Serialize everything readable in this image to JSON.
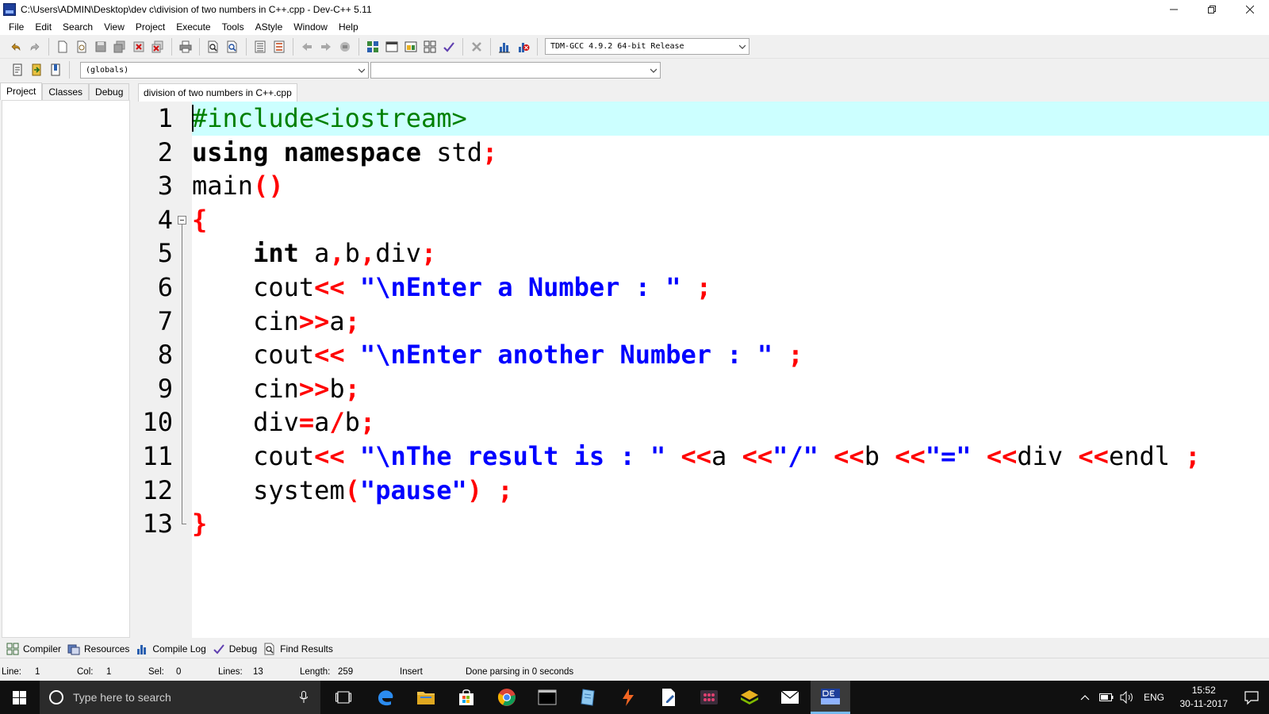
{
  "window": {
    "title": "C:\\Users\\ADMIN\\Desktop\\dev c\\division of two numbers in C++.cpp - Dev-C++ 5.11",
    "minimize": "—",
    "restore": "❐",
    "close": "✕"
  },
  "menu": [
    "File",
    "Edit",
    "Search",
    "View",
    "Project",
    "Execute",
    "Tools",
    "AStyle",
    "Window",
    "Help"
  ],
  "toolbar": {
    "compiler_selected": "TDM-GCC 4.9.2 64-bit Release",
    "scope_selected": "(globals)",
    "member_selected": ""
  },
  "left_panel": {
    "tabs": [
      "Project",
      "Classes",
      "Debug"
    ],
    "active_tab": "Project"
  },
  "editor": {
    "tab_label": "division of two numbers in C++.cpp",
    "current_line": 1,
    "lines": [
      {
        "n": "1",
        "tokens": [
          {
            "t": "#include<iostream>",
            "c": "pre"
          }
        ]
      },
      {
        "n": "2",
        "tokens": [
          {
            "t": "using",
            "c": "kw"
          },
          {
            "t": " ",
            "c": "id"
          },
          {
            "t": "namespace",
            "c": "kw"
          },
          {
            "t": " std",
            "c": "id"
          },
          {
            "t": ";",
            "c": "sym"
          }
        ]
      },
      {
        "n": "3",
        "tokens": [
          {
            "t": "main",
            "c": "id"
          },
          {
            "t": "()",
            "c": "sym"
          }
        ]
      },
      {
        "n": "4",
        "tokens": [
          {
            "t": "{",
            "c": "sym"
          }
        ]
      },
      {
        "n": "5",
        "tokens": [
          {
            "t": "    ",
            "c": "id"
          },
          {
            "t": "int",
            "c": "kw"
          },
          {
            "t": " a",
            "c": "id"
          },
          {
            "t": ",",
            "c": "sym"
          },
          {
            "t": "b",
            "c": "id"
          },
          {
            "t": ",",
            "c": "sym"
          },
          {
            "t": "div",
            "c": "id"
          },
          {
            "t": ";",
            "c": "sym"
          }
        ]
      },
      {
        "n": "6",
        "tokens": [
          {
            "t": "    cout",
            "c": "id"
          },
          {
            "t": "<<",
            "c": "sym"
          },
          {
            "t": " ",
            "c": "id"
          },
          {
            "t": "\"\\nEnter a Number : \"",
            "c": "str"
          },
          {
            "t": " ",
            "c": "id"
          },
          {
            "t": ";",
            "c": "sym"
          }
        ]
      },
      {
        "n": "7",
        "tokens": [
          {
            "t": "    cin",
            "c": "id"
          },
          {
            "t": ">>",
            "c": "sym"
          },
          {
            "t": "a",
            "c": "id"
          },
          {
            "t": ";",
            "c": "sym"
          }
        ]
      },
      {
        "n": "8",
        "tokens": [
          {
            "t": "    cout",
            "c": "id"
          },
          {
            "t": "<<",
            "c": "sym"
          },
          {
            "t": " ",
            "c": "id"
          },
          {
            "t": "\"\\nEnter another Number : \"",
            "c": "str"
          },
          {
            "t": " ",
            "c": "id"
          },
          {
            "t": ";",
            "c": "sym"
          }
        ]
      },
      {
        "n": "9",
        "tokens": [
          {
            "t": "    cin",
            "c": "id"
          },
          {
            "t": ">>",
            "c": "sym"
          },
          {
            "t": "b",
            "c": "id"
          },
          {
            "t": ";",
            "c": "sym"
          }
        ]
      },
      {
        "n": "10",
        "tokens": [
          {
            "t": "    div",
            "c": "id"
          },
          {
            "t": "=",
            "c": "sym"
          },
          {
            "t": "a",
            "c": "id"
          },
          {
            "t": "/",
            "c": "sym"
          },
          {
            "t": "b",
            "c": "id"
          },
          {
            "t": ";",
            "c": "sym"
          }
        ]
      },
      {
        "n": "11",
        "tokens": [
          {
            "t": "    cout",
            "c": "id"
          },
          {
            "t": "<<",
            "c": "sym"
          },
          {
            "t": " ",
            "c": "id"
          },
          {
            "t": "\"\\nThe result is : \"",
            "c": "str"
          },
          {
            "t": " ",
            "c": "id"
          },
          {
            "t": "<<",
            "c": "sym"
          },
          {
            "t": "a ",
            "c": "id"
          },
          {
            "t": "<<",
            "c": "sym"
          },
          {
            "t": "\"/\"",
            "c": "str"
          },
          {
            "t": " ",
            "c": "id"
          },
          {
            "t": "<<",
            "c": "sym"
          },
          {
            "t": "b ",
            "c": "id"
          },
          {
            "t": "<<",
            "c": "sym"
          },
          {
            "t": "\"=\"",
            "c": "str"
          },
          {
            "t": " ",
            "c": "id"
          },
          {
            "t": "<<",
            "c": "sym"
          },
          {
            "t": "div ",
            "c": "id"
          },
          {
            "t": "<<",
            "c": "sym"
          },
          {
            "t": "endl ",
            "c": "id"
          },
          {
            "t": ";",
            "c": "sym"
          }
        ]
      },
      {
        "n": "12",
        "tokens": [
          {
            "t": "    system",
            "c": "id"
          },
          {
            "t": "(",
            "c": "sym"
          },
          {
            "t": "\"pause\"",
            "c": "str"
          },
          {
            "t": ")",
            "c": "sym"
          },
          {
            "t": " ",
            "c": "id"
          },
          {
            "t": ";",
            "c": "sym"
          }
        ]
      },
      {
        "n": "13",
        "tokens": [
          {
            "t": "}",
            "c": "sym"
          }
        ]
      }
    ]
  },
  "bottom_tabs": [
    "Compiler",
    "Resources",
    "Compile Log",
    "Debug",
    "Find Results"
  ],
  "status": {
    "line_label": "Line:",
    "line_value": "1",
    "col_label": "Col:",
    "col_value": "1",
    "sel_label": "Sel:",
    "sel_value": "0",
    "lines_label": "Lines:",
    "lines_value": "13",
    "length_label": "Length:",
    "length_value": "259",
    "mode": "Insert",
    "message": "Done parsing in 0 seconds"
  },
  "taskbar": {
    "search_placeholder": "Type here to search",
    "apps": [
      "task-view",
      "edge",
      "file-explorer",
      "store",
      "chrome",
      "terminal",
      "notepad",
      "flash",
      "document-editor",
      "app-grid",
      "layers",
      "mail",
      "dev-cpp"
    ],
    "lang": "ENG",
    "time": "15:52",
    "date": "30-11-2017"
  },
  "colors": {
    "keyword": "#000000",
    "string": "#0000ff",
    "symbol": "#ff0000",
    "preprocessor": "#008000",
    "current_line": "#ccffff"
  }
}
